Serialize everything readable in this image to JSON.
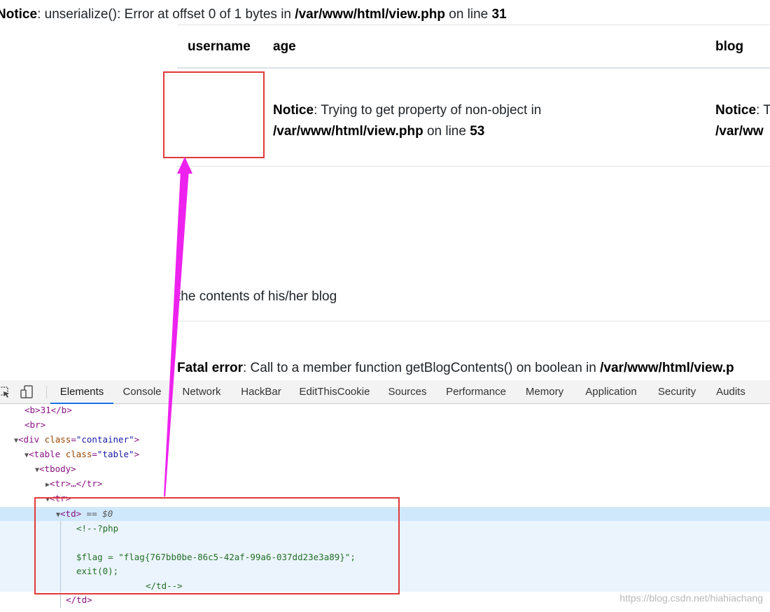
{
  "page": {
    "notice_top": {
      "label": "Notice",
      "sep": ": ",
      "text": "unserialize(): Error at offset 0 of 1 bytes in ",
      "path": "/var/www/html/view.php",
      "on_line": " on line ",
      "line": "31"
    },
    "table": {
      "headers": [
        "username",
        "age",
        "blog"
      ],
      "age_cell": {
        "label": "Notice",
        "sep": ": ",
        "text": "Trying to get property of non-object in",
        "path": "/var/www/html/view.php",
        "on_line": " on line ",
        "line": "53"
      },
      "blog_cell": {
        "label": "Notice",
        "sep": ": T",
        "path": "/var/ww"
      }
    },
    "blog_text": "the contents of his/her blog",
    "fatal": {
      "label": "Fatal error",
      "sep": ": ",
      "text": "Call to a member function getBlogContents() on boolean in ",
      "path": "/var/www/html/view.p"
    }
  },
  "devtools": {
    "tabs": [
      "Elements",
      "Console",
      "Network",
      "HackBar",
      "EditThisCookie",
      "Sources",
      "Performance",
      "Memory",
      "Application",
      "Security",
      "Audits"
    ],
    "active_tab": "Elements",
    "icons": [
      "inspect-element-icon",
      "device-toolbar-icon"
    ],
    "dom": {
      "line1": "<b>31</b>",
      "line2": "<br>",
      "div_open": "<div ",
      "div_attr": "class",
      "div_val": "\"container\"",
      "table_open": "<table ",
      "table_attr": "class",
      "table_val": "\"table\"",
      "tbody": "<tbody>",
      "tr_collapsed": "<tr>…</tr>",
      "tr_open": "<tr>",
      "td_open": "<td>",
      "td_ref": " == $0",
      "comment1": "<!--?php",
      "comment2": "$flag = \"flag{767bb0be-86c5-42af-99a6-037dd23e3a89}\";",
      "comment3": "exit(0);",
      "comment4": "</td-->",
      "td_close": "</td>"
    }
  },
  "watermark": "https://blog.csdn.net/hiahiachang",
  "colors": {
    "annotation_box": "#e03a3a",
    "annotation_arrow": "#ee22ee",
    "selection": "#cfe8fc"
  }
}
